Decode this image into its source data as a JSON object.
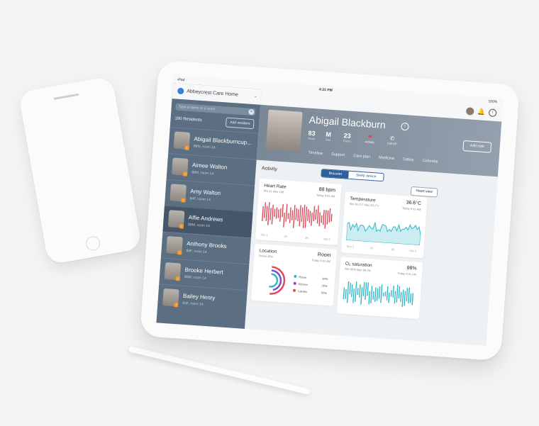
{
  "status": {
    "left": "iPad",
    "time": "4:21 PM",
    "battery": "100%"
  },
  "home": {
    "title": "Abbeycrest Care Home"
  },
  "left": {
    "search_placeholder": "Type a name or a room",
    "residents_count": "180 Residents",
    "add_resident": "Add resident",
    "residents": [
      {
        "name": "Abigail Blackburncup...",
        "sub": "88M, room 14",
        "selected": false
      },
      {
        "name": "Aimee Walton",
        "sub": "88M, room 14",
        "selected": false
      },
      {
        "name": "Amy Walton",
        "sub": "84F, room 14",
        "selected": false
      },
      {
        "name": "Alfie Andrews",
        "sub": "88M, room 14",
        "selected": true
      },
      {
        "name": "Anthony Brooks",
        "sub": "84F, room 14",
        "selected": false
      },
      {
        "name": "Brooke Herbert",
        "sub": "88M, room 14",
        "selected": false
      },
      {
        "name": "Bailey Henry",
        "sub": "84F, room 14",
        "selected": false
      }
    ]
  },
  "hero": {
    "name": "Abigail Blackburn",
    "stats": [
      {
        "value": "83",
        "key": "Years"
      },
      {
        "value": "M",
        "key": "Sex"
      },
      {
        "value": "23",
        "key": "Room"
      }
    ],
    "activity_label": "Activity",
    "call_label": "Call GP",
    "add_note": "Add note",
    "tabs": [
      "Timeline",
      "Support",
      "Care plan",
      "Medicine",
      "Safety",
      "Calendar"
    ]
  },
  "activity": {
    "title": "Activity",
    "seg_on": "Bracelet",
    "seg_off": "Sleep device",
    "heart": {
      "title": "Heart Rate",
      "sub": "Min 41 Max 196",
      "value": "88 bpm",
      "time": "Today 9:41 AM",
      "xlabels": [
        "Sun 1",
        "10",
        "16",
        "Oct 2"
      ]
    },
    "heart_view": "Heart view",
    "temp": {
      "title": "Temperature",
      "sub": "Min 36.2°C Max 39.2°C",
      "value": "36.6°C",
      "time": "Today 9:41 AM",
      "xlabels": [
        "Sun 1",
        "10",
        "16",
        "Oct 2"
      ]
    },
    "location": {
      "title": "Location",
      "sub": "Room 45%",
      "value": "Room",
      "time": "Today 9:41 AM",
      "legend": [
        {
          "label": "Room",
          "pct": "30%",
          "color": "#2fb8c9"
        },
        {
          "label": "Kitchen",
          "pct": "20%",
          "color": "#7a4fd0"
        },
        {
          "label": "Garden",
          "pct": "50%",
          "color": "#e2475a"
        }
      ]
    },
    "o2": {
      "title": "O₂ saturation",
      "sub": "Min 95% Max 99.2%",
      "value": "98%",
      "time": "Today 9:41 AM",
      "xlabels": [
        "Sun 1",
        "10",
        "16",
        "Oct 2"
      ]
    }
  },
  "colors": {
    "heart": "#e2475a",
    "temp": "#2fb8c9",
    "o2": "#2fb8c9",
    "accent": "#2f5f9a"
  }
}
